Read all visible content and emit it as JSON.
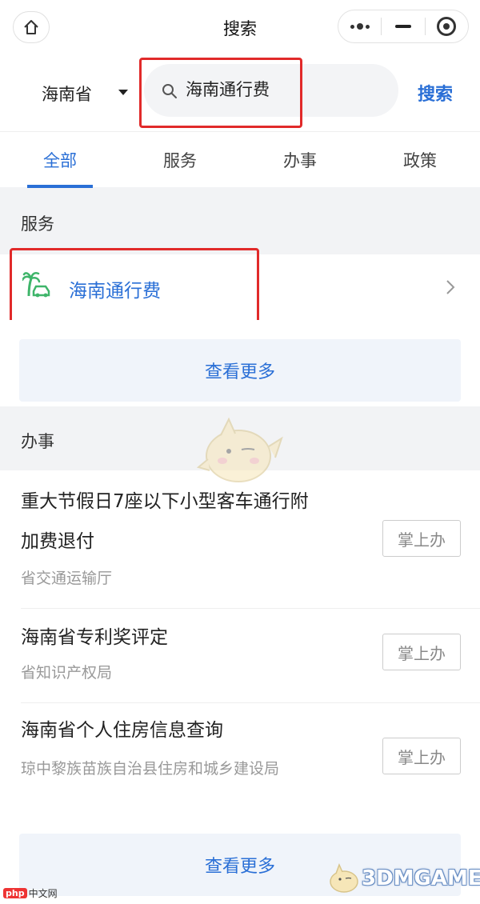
{
  "nav": {
    "title": "搜索",
    "home_icon": "home-icon",
    "more_icon": "more-dots-icon",
    "minimize_icon": "minimize-icon",
    "close_icon": "target-close-icon"
  },
  "search": {
    "region": "海南省",
    "query": "海南通行费",
    "button": "搜索"
  },
  "tabs": [
    {
      "label": "全部",
      "active": true
    },
    {
      "label": "服务",
      "active": false
    },
    {
      "label": "办事",
      "active": false
    },
    {
      "label": "政策",
      "active": false
    }
  ],
  "services": {
    "section_title": "服务",
    "items": [
      {
        "name": "海南通行费",
        "icon": "palm-car-logo-icon"
      }
    ],
    "more": "查看更多"
  },
  "matters": {
    "section_title": "办事",
    "items": [
      {
        "title": "重大节假日7座以下小型客车通行附加费退付",
        "dept": "省交通运输厅",
        "action": "掌上办"
      },
      {
        "title": "海南省专利奖评定",
        "dept": "省知识产权局",
        "action": "掌上办"
      },
      {
        "title": "海南省个人住房信息查询",
        "dept": "琼中黎族苗族自治县住房和城乡建设局",
        "action": "掌上办"
      }
    ],
    "more": "查看更多"
  },
  "watermarks": {
    "left_badge": "php",
    "left_text": "中文网",
    "right_text": "3DMGAME"
  },
  "colors": {
    "accent": "#2a6fd6",
    "highlight": "#e12a2a",
    "logo_green": "#3fb56a"
  }
}
